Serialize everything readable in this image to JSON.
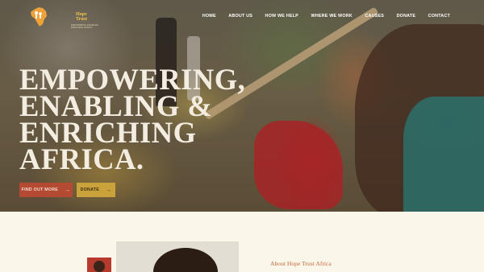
{
  "brand": {
    "logo_title": "Hope Trust",
    "logo_subtitle": "EMPOWERING ENABLING ENRICHING AFRICA",
    "accent": "#f0c24a"
  },
  "nav": {
    "items": [
      {
        "label": "HOME"
      },
      {
        "label": "ABOUT US"
      },
      {
        "label": "HOW WE HELP"
      },
      {
        "label": "WHERE WE WORK"
      },
      {
        "label": "CAUSES"
      },
      {
        "label": "DONATE"
      },
      {
        "label": "CONTACT"
      }
    ]
  },
  "hero": {
    "headline_lines": [
      "EMPOWERING,",
      "ENABLING &",
      "ENRICHING",
      "AFRICA."
    ],
    "primary_button": "FIND OUT MORE",
    "secondary_button": "DONATE",
    "arrow_glyph": "→",
    "primary_color": "#b44a32",
    "secondary_color": "#c9a23c"
  },
  "about": {
    "label": "About Hope Trust Africa",
    "label_color": "#c46a3c"
  }
}
